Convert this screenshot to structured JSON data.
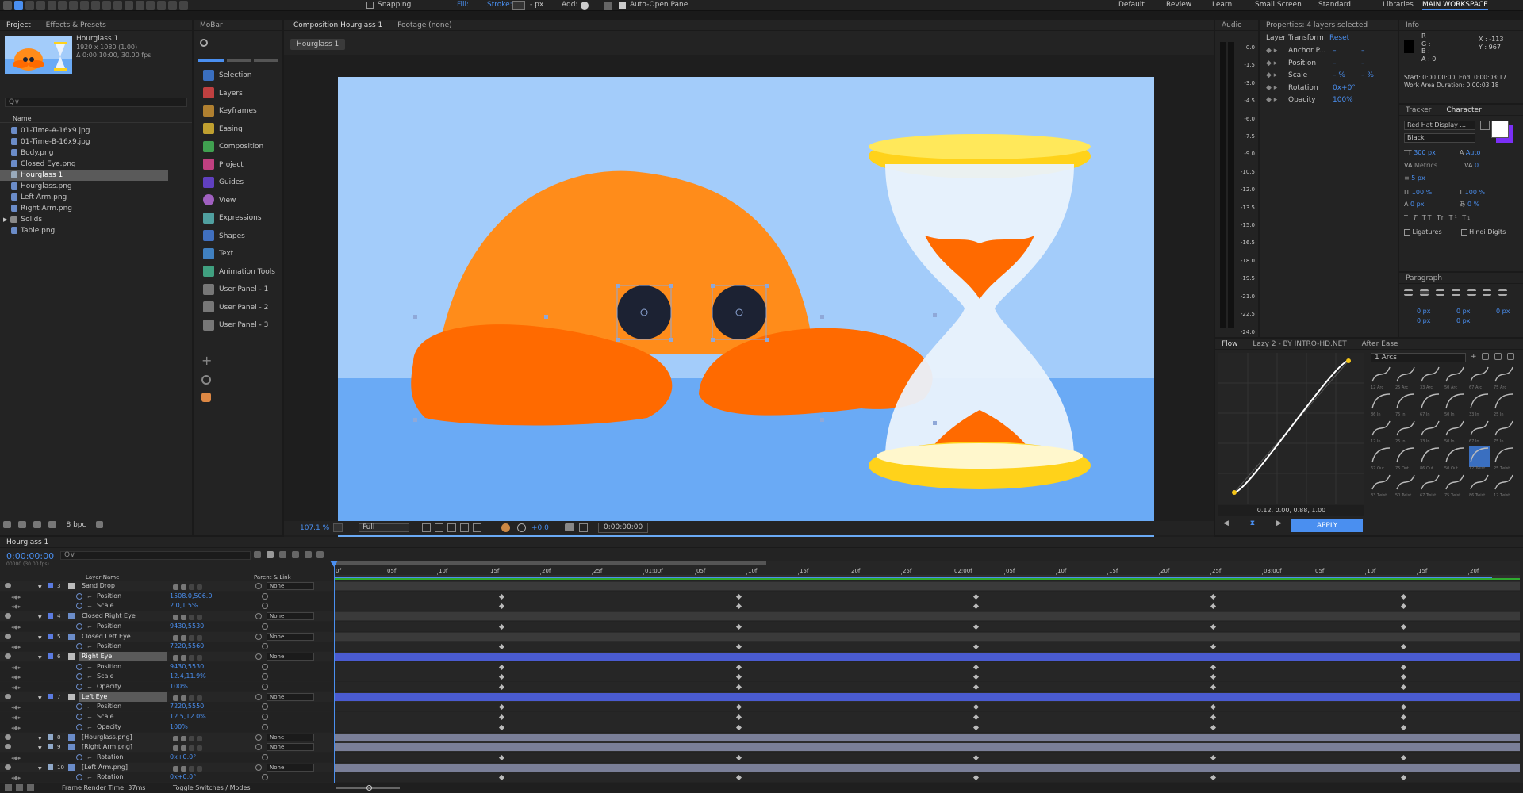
{
  "toolbar": {
    "snapping": "Snapping",
    "fill": "Fill:",
    "stroke": "Stroke:",
    "stroke_px": "- px",
    "add": "Add:",
    "auto_open": "Auto-Open Panel",
    "workspaces": [
      "Default",
      "Review",
      "Learn",
      "Small Screen",
      "Standard",
      "Libraries",
      "MAIN WORKSPACE"
    ]
  },
  "project": {
    "tabs": [
      "Project",
      "Effects & Presets"
    ],
    "item_name": "Hourglass 1",
    "item_size": "1920 x 1080 (1.00)",
    "item_duration": "Δ 0:00:10:00, 30.00 fps",
    "search_placeholder": "Q∨",
    "col_name": "Name",
    "files": [
      "01-Time-A-16x9.jpg",
      "01-Time-B-16x9.jpg",
      "Body.png",
      "Closed Eye.png",
      "Hourglass 1",
      "Hourglass.png",
      "Left Arm.png",
      "Right Arm.png",
      "Solids",
      "Table.png"
    ],
    "bpc": "8 bpc"
  },
  "mobar": {
    "title": "MoBar",
    "items": [
      "Selection",
      "Layers",
      "Keyframes",
      "Easing",
      "Composition",
      "Project",
      "Guides",
      "View",
      "Expressions",
      "Shapes",
      "Text",
      "Animation Tools",
      "User Panel - 1",
      "User Panel - 2",
      "User Panel - 3"
    ]
  },
  "comp": {
    "tab": "Composition Hourglass 1",
    "footage": "Footage (none)",
    "breadcrumb": "Hourglass 1",
    "zoom": "107.1 %",
    "quality": "Full",
    "exposure": "+0.0",
    "timecode": "0:00:00:00"
  },
  "audio": {
    "title": "Audio",
    "scale": [
      "0.0",
      "-1.5",
      "-3.0",
      "-4.5",
      "-6.0",
      "-7.5",
      "-9.0",
      "-10.5",
      "-12.0",
      "-13.5",
      "-15.0",
      "-16.5",
      "-18.0",
      "-19.5",
      "-21.0",
      "-22.5",
      "-24.0"
    ]
  },
  "properties": {
    "title": "Properties: 4 layers selected",
    "section": "Layer Transform",
    "reset": "Reset",
    "rows": [
      {
        "label": "Anchor P...",
        "v1": "–",
        "v2": "–"
      },
      {
        "label": "Position",
        "v1": "–",
        "v2": "–"
      },
      {
        "label": "Scale",
        "v1": "– %",
        "v2": "– %"
      },
      {
        "label": "Rotation",
        "v1": "0x+0°",
        "v2": ""
      },
      {
        "label": "Opacity",
        "v1": "100%",
        "v2": ""
      }
    ]
  },
  "info": {
    "title": "Info",
    "rgba": [
      "R :",
      "G :",
      "B :",
      "A : 0"
    ],
    "x": "X : -113",
    "y": "Y : 967",
    "start": "Start: 0:00:00:00, End: 0:00:03:17",
    "work": "Work Area Duration: 0:00:03:18"
  },
  "character": {
    "tabs": [
      "Tracker",
      "Character"
    ],
    "font": "Red Hat Display ...",
    "style": "Black",
    "size": "300 px",
    "leading": "Auto",
    "kerning": "Metrics",
    "tracking": "0",
    "stroke": "5 px",
    "vscale": "100 %",
    "hscale": "100 %",
    "baseline": "0 px",
    "tsume": "0 %",
    "ligatures": "Ligatures",
    "hindi": "Hindi Digits",
    "text_styles": [
      "T",
      "T",
      "TT",
      "Tr",
      "T¹",
      "T₁"
    ],
    "fill_color": "#ffffff",
    "stroke_color": "#7b2ff7"
  },
  "paragraph": {
    "title": "Paragraph",
    "vals": [
      "0 px",
      "0 px",
      "0 px",
      "0 px",
      "0 px"
    ]
  },
  "flow": {
    "tabs": [
      "Flow",
      "Lazy 2 - BY INTRO-HD.NET",
      "After Ease"
    ],
    "preset": "1 Arcs",
    "value": "0.12, 0.00, 0.88, 1.00",
    "apply": "APPLY",
    "curve": [
      0.12,
      0.0,
      0.88,
      1.0
    ],
    "grid_labels": [
      "12 Arc",
      "25 Arc",
      "33 Arc",
      "50 Arc",
      "67 Arc",
      "75 Arc",
      "86 In",
      "75 In",
      "67 In",
      "50 In",
      "33 In",
      "25 In",
      "12 In",
      "25 In",
      "33 In",
      "50 In",
      "67 In",
      "75 In",
      "67 Out",
      "75 Out",
      "86 Out",
      "50 Out",
      "12 Twist",
      "25 Twist",
      "33 Twist",
      "50 Twist",
      "67 Twist",
      "75 Twist",
      "86 Twist",
      "12 Twist"
    ]
  },
  "timeline": {
    "comp_tab": "Hourglass 1",
    "timecode": "0:00:00:00",
    "timecode_sub": "00000 (30.00 fps)",
    "search_placeholder": "Q∨",
    "col_layer": "Layer Name",
    "col_parent": "Parent & Link",
    "footer_render": "Frame Render Time: 37ms",
    "footer_toggle": "Toggle Switches / Modes",
    "ruler": [
      "0f",
      "05f",
      "10f",
      "15f",
      "20f",
      "25f",
      "01:00f",
      "05f",
      "10f",
      "15f",
      "20f",
      "25f",
      "02:00f",
      "05f",
      "10f",
      "15f",
      "20f",
      "25f",
      "03:00f",
      "05f",
      "10f",
      "15f",
      "20f"
    ],
    "rows": [
      {
        "num": "3",
        "name": "Sand Drop",
        "type": "layer",
        "value": "",
        "parent": "None",
        "star": true,
        "color": "#5b7be0"
      },
      {
        "num": "",
        "name": "Position",
        "type": "prop",
        "value": "1508.0,506.0"
      },
      {
        "num": "",
        "name": "Scale",
        "type": "prop",
        "value": "2.0,1.5%"
      },
      {
        "num": "4",
        "name": "Closed Right Eye",
        "type": "layer",
        "value": "",
        "parent": "None",
        "star": false,
        "color": "#5b7be0"
      },
      {
        "num": "",
        "name": "Position",
        "type": "prop",
        "value": "9430,5530"
      },
      {
        "num": "5",
        "name": "Closed Left Eye",
        "type": "layer",
        "value": "",
        "parent": "None",
        "star": false,
        "color": "#5b7be0"
      },
      {
        "num": "",
        "name": "Position",
        "type": "prop",
        "value": "7220,5560"
      },
      {
        "num": "6",
        "name": "Right Eye",
        "type": "layer",
        "value": "",
        "parent": "None",
        "star": true,
        "color": "#5b7be0"
      },
      {
        "num": "",
        "name": "Position",
        "type": "prop",
        "value": "9430,5530"
      },
      {
        "num": "",
        "name": "Scale",
        "type": "prop",
        "value": "12.4,11.9%"
      },
      {
        "num": "",
        "name": "Opacity",
        "type": "prop",
        "value": "100%"
      },
      {
        "num": "7",
        "name": "Left Eye",
        "type": "layer",
        "value": "",
        "parent": "None",
        "star": true,
        "color": "#5b7be0"
      },
      {
        "num": "",
        "name": "Position",
        "type": "prop",
        "value": "7220,5550"
      },
      {
        "num": "",
        "name": "Scale",
        "type": "prop",
        "value": "12.5,12.0%"
      },
      {
        "num": "",
        "name": "Opacity",
        "type": "prop",
        "value": "100%"
      },
      {
        "num": "8",
        "name": "[Hourglass.png]",
        "type": "layer",
        "value": "",
        "parent": "None",
        "star": false,
        "color": "#8fa8c8"
      },
      {
        "num": "9",
        "name": "[Right Arm.png]",
        "type": "layer",
        "value": "",
        "parent": "None",
        "star": false,
        "color": "#8fa8c8"
      },
      {
        "num": "",
        "name": "Rotation",
        "type": "prop",
        "value": "0x+0.0°"
      },
      {
        "num": "10",
        "name": "[Left Arm.png]",
        "type": "layer",
        "value": "",
        "parent": "None",
        "star": false,
        "color": "#8fa8c8"
      },
      {
        "num": "",
        "name": "Rotation",
        "type": "prop",
        "value": "0x+0.0°"
      }
    ]
  },
  "colors": {
    "accent": "#4a8ff0",
    "sky": "#a3ccfa",
    "water": "#6aaaf5",
    "orange": "#ff8c1a",
    "orange_dark": "#ff6a00",
    "eye": "#1c2233",
    "hourglass_gold": "#ffd21a",
    "hourglass_glass": "#eaf2fc"
  }
}
